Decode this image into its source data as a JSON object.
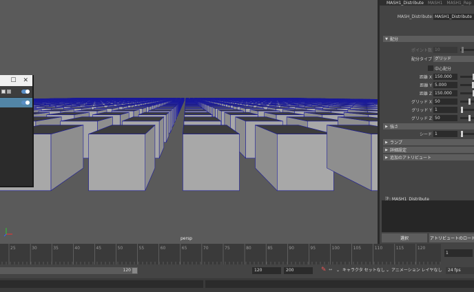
{
  "viewport": {
    "camera_label": "persp"
  },
  "attr_editor": {
    "tabs": [
      "MASH1_Distribute",
      "MASH1",
      "MASH1_Rep"
    ],
    "node_label": "MASH_Distribute:",
    "node_value": "MASH1_Distribute",
    "section_distribute": "配分",
    "point_count_label": "ポイント数",
    "point_count_value": "10",
    "dist_type_label": "配分タイプ",
    "dist_type_value": "グリッド",
    "center_dist_label": "中心配分",
    "dist_x_label": "距離 X",
    "dist_x_value": "150.000",
    "dist_y_label": "距離 Y",
    "dist_y_value": "5.000",
    "dist_z_label": "距離 Z",
    "dist_z_value": "150.000",
    "grid_x_label": "グリッド X",
    "grid_x_value": "50",
    "grid_y_label": "グリッド Y",
    "grid_y_value": "1",
    "grid_z_label": "グリッド Z",
    "grid_z_value": "50",
    "section_strength": "強さ",
    "seed_label": "シード",
    "seed_value": "1",
    "section_ramp": "ランプ",
    "section_advanced": "詳細設定",
    "section_extra_attrs": "追加のアトリビュート",
    "note_label": "注: MASH1_Distribute",
    "select_button": "選択",
    "load_attrs_button": "アトリビュートのロード"
  },
  "timeline": {
    "ticks": [
      "25",
      "30",
      "35",
      "40",
      "45",
      "50",
      "55",
      "60",
      "65",
      "70",
      "75",
      "80",
      "85",
      "90",
      "95",
      "100",
      "105",
      "110",
      "115",
      "120"
    ],
    "current_frame": "1"
  },
  "range": {
    "end_value": "120",
    "range_end": "120",
    "anim_end": "200",
    "character_set": "キャラクタ セットなし",
    "anim_layer": "アニメーション レイヤなし",
    "fps": "24 fps"
  },
  "colors": {
    "accent_blue": "#5285a6",
    "wire_blue": "#1a1a9a",
    "cube_face": "#a8a8a8",
    "cube_top": "#3c3c3c"
  }
}
